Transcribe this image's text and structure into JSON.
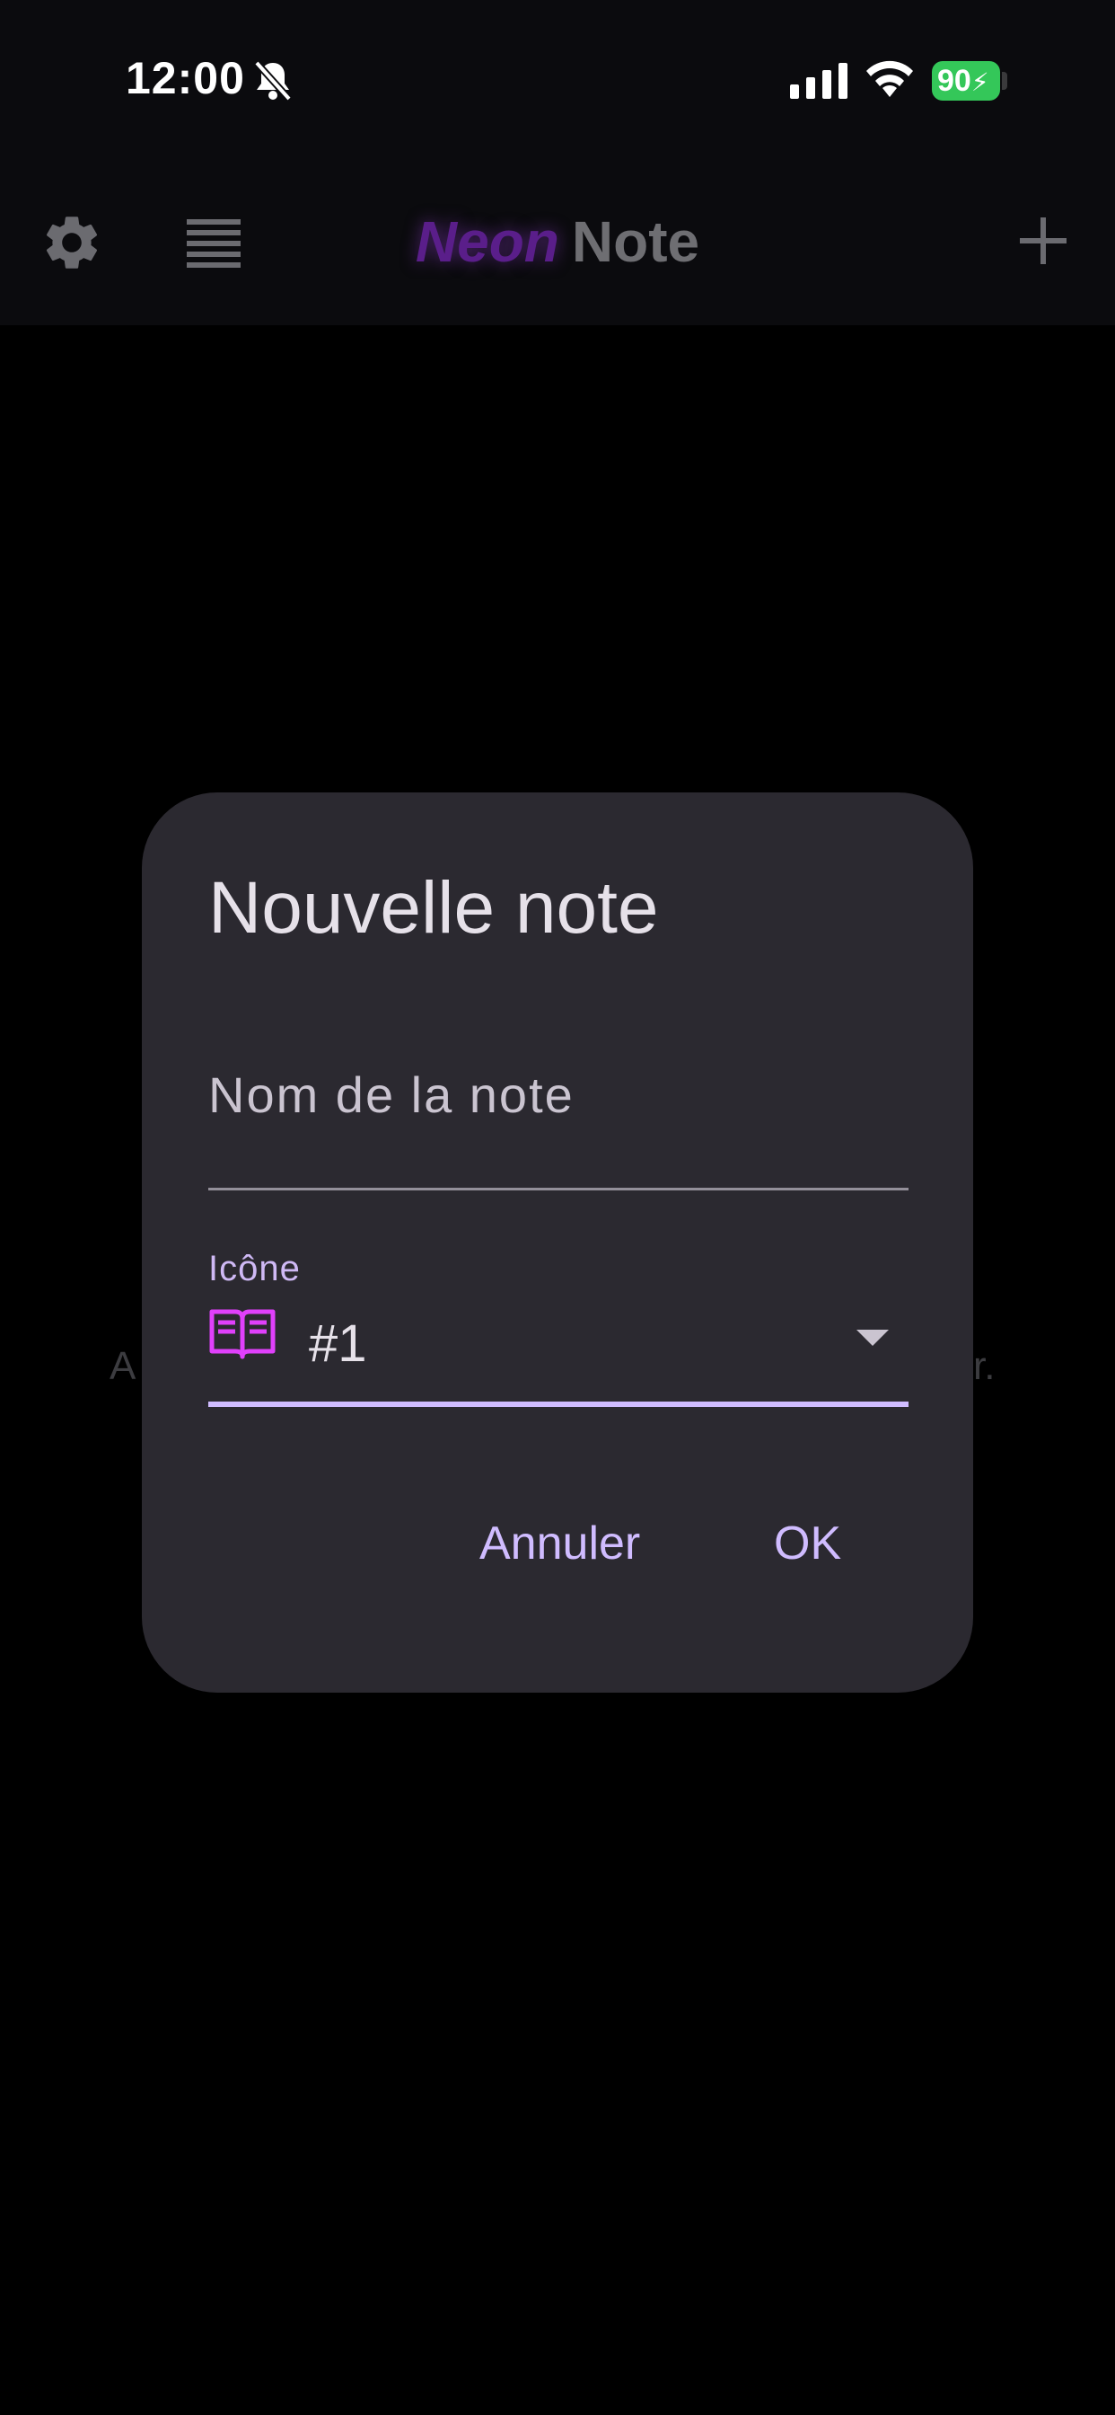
{
  "status_bar": {
    "time": "12:00",
    "battery": "90"
  },
  "app_bar": {
    "title_neon": "Neon",
    "title_note": "Note"
  },
  "background": {
    "hint_left": "A",
    "hint_right": "r."
  },
  "dialog": {
    "title": "Nouvelle note",
    "name_field": {
      "placeholder": "Nom de la note",
      "value": ""
    },
    "icon_field": {
      "label": "Icône",
      "value": "#1",
      "icon": "book-icon"
    },
    "cancel_label": "Annuler",
    "ok_label": "OK"
  },
  "colors": {
    "accent": "#d0bcff",
    "dialog_bg": "#2b2930",
    "neon_purple": "#5a1e8a",
    "icon_magenta": "#e040fb",
    "battery_green": "#34c759"
  }
}
